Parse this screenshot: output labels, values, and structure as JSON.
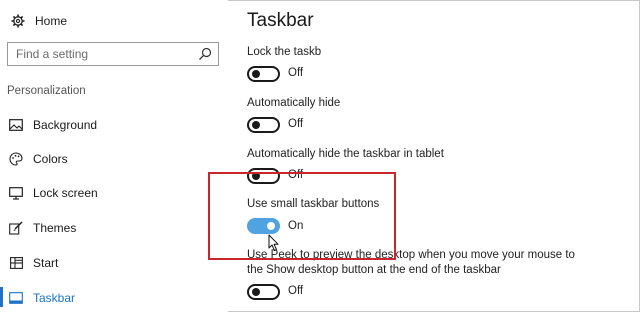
{
  "sidebar": {
    "home_label": "Home",
    "search_placeholder": "Find a setting",
    "section_title": "Personalization",
    "items": [
      {
        "label": "Background",
        "icon": "image-icon"
      },
      {
        "label": "Colors",
        "icon": "palette-icon"
      },
      {
        "label": "Lock screen",
        "icon": "monitor-icon"
      },
      {
        "label": "Themes",
        "icon": "brush-icon"
      },
      {
        "label": "Start",
        "icon": "grid-icon"
      },
      {
        "label": "Taskbar",
        "icon": "taskbar-icon",
        "active": true
      }
    ]
  },
  "main": {
    "title": "Taskbar",
    "settings": [
      {
        "label": "Lock the taskb",
        "state": "Off"
      },
      {
        "label": "Automatically hide",
        "state": "Off"
      },
      {
        "label": "Automatically hide the taskbar in tablet",
        "state": "Off"
      },
      {
        "label": "Use small taskbar buttons",
        "state": "On"
      },
      {
        "label_line1": "Use Peek to preview the desktop when you move your mouse to",
        "label_line2": "the Show desktop button at the end of the taskbar",
        "state": "Off"
      }
    ]
  },
  "colors": {
    "accent": "#1e73c8",
    "toggle_on": "#4ea3e0",
    "highlight": "#c8262c"
  }
}
